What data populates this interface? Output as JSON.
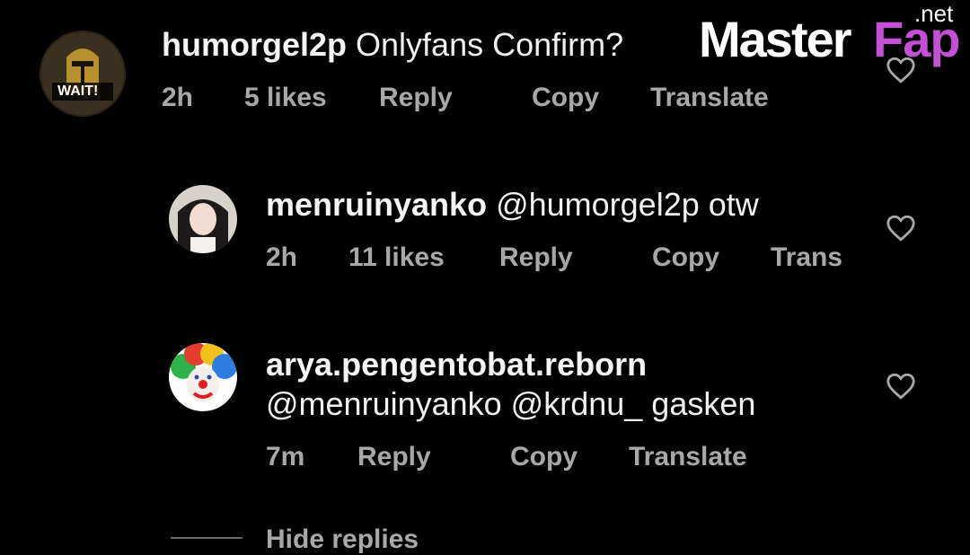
{
  "comments": [
    {
      "username": "humorgel2p",
      "text": "Onlyfans Confirm?",
      "avatar_badge": "WAIT!",
      "time": "2h",
      "likes": "5 likes",
      "reply": "Reply",
      "copy": "Copy",
      "translate": "Translate"
    },
    {
      "username": "menruinyanko",
      "text": "@humorgel2p otw",
      "time": "2h",
      "likes": "11 likes",
      "reply": "Reply",
      "copy": "Copy",
      "translate": "Trans"
    },
    {
      "username": "arya.pengentobat.reborn",
      "text": "@menruinyanko @krdnu_ gasken",
      "time": "7m",
      "reply": "Reply",
      "copy": "Copy",
      "translate": "Translate"
    }
  ],
  "hide_replies": "Hide replies",
  "watermark": {
    "master": "Master",
    "fap": "Fap",
    "net": ".net"
  },
  "icons": {
    "like": "heart-outline-icon"
  },
  "colors": {
    "background": "#000000",
    "meta": "#a8a8a8",
    "watermark_accent": "#c64fd8"
  }
}
